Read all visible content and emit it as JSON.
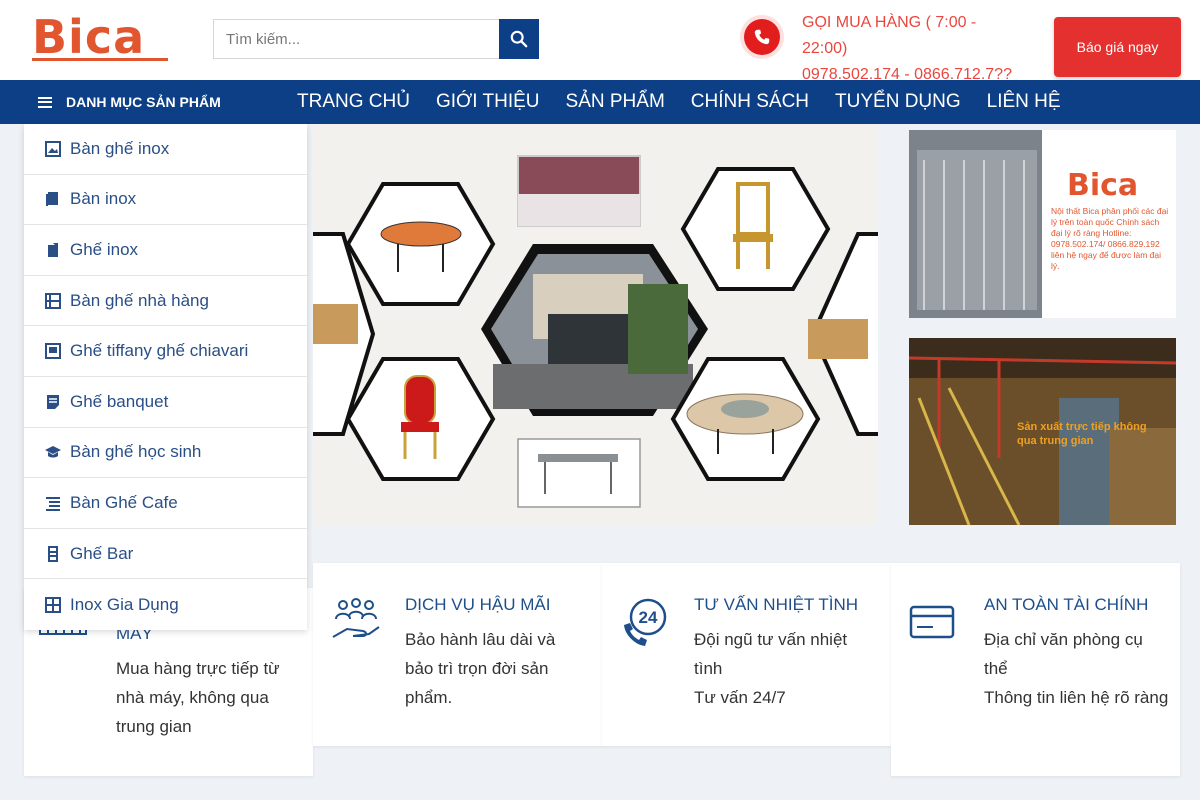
{
  "header": {
    "logo": "Bica",
    "search_placeholder": "Tìm kiếm...",
    "hotline_label": "GỌI MUA HÀNG ( 7:00 - 22:00)",
    "hotline_numbers": "0978.502.174 - 0866.712.7??",
    "quote_button": "Báo giá ngay"
  },
  "nav": {
    "category_toggle": "DANH MỤC SẢN PHẨM",
    "items": [
      "TRANG CHỦ",
      "GIỚI THIỆU",
      "SẢN PHẨM",
      "CHÍNH SÁCH",
      "TUYỂN DỤNG",
      "LIÊN HỆ"
    ]
  },
  "categories": [
    {
      "label": "Bàn ghế inox",
      "icon": "image-icon"
    },
    {
      "label": "Bàn inox",
      "icon": "book-icon"
    },
    {
      "label": "Ghế inox",
      "icon": "bookmark-icon"
    },
    {
      "label": "Bàn ghế nhà hàng",
      "icon": "film-icon"
    },
    {
      "label": "Ghế tiffany ghế chiavari",
      "icon": "gallery-icon"
    },
    {
      "label": "Ghế banquet",
      "icon": "document-icon"
    },
    {
      "label": "Bàn ghế học sinh",
      "icon": "graduation-cap-icon"
    },
    {
      "label": "Bàn Ghế Cafe",
      "icon": "list-icon"
    },
    {
      "label": "Ghế Bar",
      "icon": "bar-stool-icon"
    },
    {
      "label": "Inox Gia Dụng",
      "icon": "grid-icon"
    }
  ],
  "side_banner": {
    "brand": "Bica",
    "text": "Nội thất Bica phân phối các đại lý trên toàn quốc Chính sách đại lý rõ ràng Hotline: 0978.502.174/ 0866.829.192 liên hệ ngay để được làm đại lý.",
    "factory_caption": "Sản xuất trực tiếp không qua trung gian"
  },
  "features": [
    {
      "title": "MÁY",
      "text": "Mua hàng trực tiếp từ nhà máy, không qua trung gian",
      "icon": "factory-icon"
    },
    {
      "title": "DỊCH VỤ HẬU MÃI",
      "text": "Bảo hành lâu dài và bảo trì trọn đời sản phẩm.",
      "icon": "people-hand-icon"
    },
    {
      "title": "TƯ VẤN NHIỆT TÌNH",
      "text": "Đội ngũ tư vấn nhiệt tình",
      "text2": "Tư vấn 24/7",
      "icon": "phone-24-icon"
    },
    {
      "title": "AN TOÀN TÀI CHÍNH",
      "text": "Địa chỉ văn phòng cụ thể",
      "text2": "Thông tin liên hệ rõ ràng",
      "icon": "credit-card-icon"
    }
  ],
  "colors": {
    "brand": "#e2562f",
    "nav": "#0d3f86",
    "quote": "#e53030",
    "hotline": "#e9473e"
  }
}
